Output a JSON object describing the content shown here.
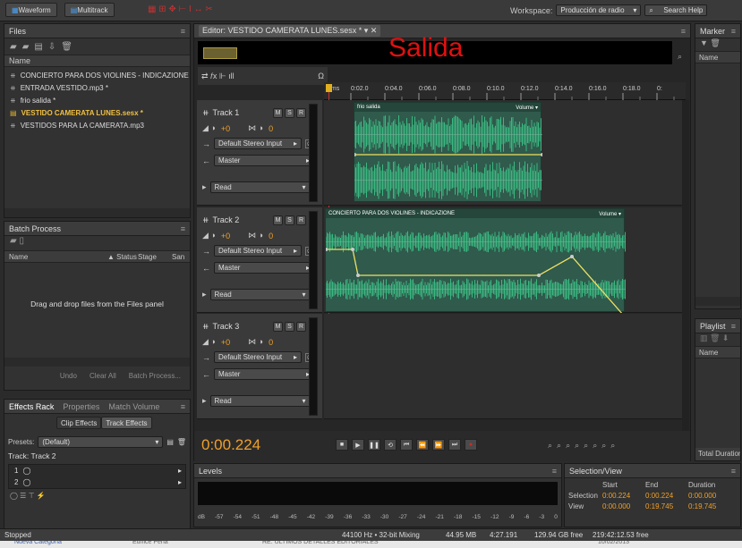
{
  "topbar": {
    "waveform": "Waveform",
    "multitrack": "Multitrack",
    "workspace_label": "Workspace:",
    "workspace_value": "Producción de radio",
    "search": "Search Help"
  },
  "files": {
    "title": "Files",
    "col_name": "Name",
    "items": [
      "CONCIERTO PARA DOS VIOLINES - INDICAZIONE",
      "ENTRADA VESTIDO.mp3 *",
      "frio salida *",
      "VESTIDO CAMERATA LUNES.sesx *",
      "VESTIDOS PARA LA CAMERATA.mp3"
    ]
  },
  "batch": {
    "title": "Batch Process",
    "cols": [
      "Name",
      "Status",
      "Stage",
      "San"
    ],
    "empty": "Drag and drop files from the Files panel",
    "buttons": [
      "Undo",
      "Clear All",
      "Batch Process..."
    ]
  },
  "effects": {
    "tabs": [
      "Effects Rack",
      "Properties",
      "Match Volume"
    ],
    "sub_tabs": [
      "Clip Effects",
      "Track Effects"
    ],
    "presets_label": "Presets:",
    "presets_value": "(Default)",
    "track_label": "Track: Track 2",
    "slots": [
      "1",
      "2"
    ]
  },
  "editor": {
    "title": "Editor: VESTIDO CAMERATA LUNES.sesx *",
    "overlay": "Salida",
    "time_current": "0:00.224",
    "ruler": [
      "hms",
      "0:02.0",
      "0:04.0",
      "0:06.0",
      "0:08.0",
      "0:10.0",
      "0:12.0",
      "0:14.0",
      "0:16.0",
      "0:18.0",
      "0:"
    ]
  },
  "tracks": [
    {
      "name": "Track 1",
      "vol": "+0",
      "pan": "0",
      "input": "Default Stereo Input",
      "output": "Master",
      "mode": "Read",
      "clip": "frio salida",
      "clip_param": "Volume"
    },
    {
      "name": "Track 2",
      "vol": "+0",
      "pan": "0",
      "input": "Default Stereo Input",
      "output": "Master",
      "mode": "Read",
      "clip": "CONCIERTO PARA DOS VIOLINES - INDICAZIONE",
      "clip_param": "Volume"
    },
    {
      "name": "Track 3",
      "vol": "+0",
      "pan": "0",
      "input": "Default Stereo Input",
      "output": "Master",
      "mode": "Read"
    }
  ],
  "track_buttons": [
    "M",
    "S",
    "R"
  ],
  "markers": {
    "title": "Marker",
    "col": "Name"
  },
  "playlist": {
    "title": "Playlist",
    "col": "Name",
    "total": "Total Duration"
  },
  "levels": {
    "title": "Levels",
    "scale": [
      "dB",
      "-57",
      "-54",
      "-51",
      "-48",
      "-45",
      "-42",
      "-39",
      "-36",
      "-33",
      "-30",
      "-27",
      "-24",
      "-21",
      "-18",
      "-15",
      "-12",
      "-9",
      "-6",
      "-3",
      "0"
    ]
  },
  "selview": {
    "title": "Selection/View",
    "cols": [
      "Start",
      "End",
      "Duration"
    ],
    "rows": [
      {
        "label": "Selection",
        "start": "0:00.224",
        "end": "0:00.224",
        "dur": "0:00.000"
      },
      {
        "label": "View",
        "start": "0:00.000",
        "end": "0:19.745",
        "dur": "0:19.745"
      }
    ]
  },
  "status": {
    "left": "Stopped",
    "rate": "44100 Hz • 32-bit Mixing",
    "mem": "44.95 MB",
    "dur": "4:27.191",
    "free": "129.94 GB free",
    "free_time": "219:42:12.53 free"
  },
  "taskbar": {
    "a": "Nueva Categoría",
    "b": "Eunice Peña",
    "c": "RE: ULTIMOS DETALLES EDITORIALES",
    "d": "10/02/2013"
  },
  "colors": {
    "accent": "#4aa0f0",
    "orange": "#f0a02a",
    "wave": "#3fcf8e",
    "overlay": "#e01010"
  }
}
